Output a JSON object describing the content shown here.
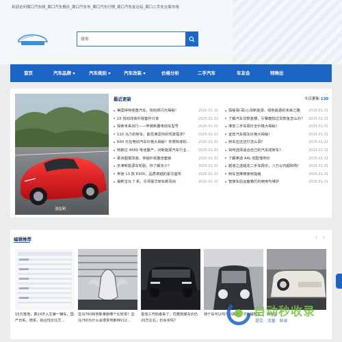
{
  "header": {
    "welcome": "欢迎访问周口汽车网_周口汽车报价_周口汽车市_周口汽车行情_周口汽车友论坛_周口二手车交易市场",
    "logo_text": "周口汽车网",
    "search_placeholder": "搜索"
  },
  "nav": {
    "items": [
      {
        "label": "首页",
        "caret": false
      },
      {
        "label": "汽车品牌",
        "caret": true
      },
      {
        "label": "汽车类别",
        "caret": true
      },
      {
        "label": "汽车改装",
        "caret": true
      },
      {
        "label": "价格分析",
        "caret": false
      },
      {
        "label": "二手汽车",
        "caret": false
      },
      {
        "label": "车友会",
        "caret": false
      },
      {
        "label": "特殊拉",
        "caret": false
      }
    ]
  },
  "hero": {
    "caption": "法拉利"
  },
  "latest": {
    "title": "最近更新",
    "items": [
      {
        "title": "美国得特塔重汽车，快险频闪光揭秘！",
        "date": "2025-01-31"
      },
      {
        "title": "15 悦动改装外观套件分享",
        "date": "2025-01-31"
      },
      {
        "title": "探索未来出行——奔驰新叠电动车型号",
        "date": "2025-01-31"
      },
      {
        "title": "110 马力的轿车，能否满足你的驾驶需求？",
        "date": "2025-01-31"
      },
      {
        "title": "600 元在电动汽车价格大揭秘！你想知道的...",
        "date": "2025-01-31"
      },
      {
        "title": "特斯拉 4680 电池量产，对新能源汽车行业...",
        "date": "2025-01-31"
      },
      {
        "title": "歌诗图报改装，将袖外观量佳套装",
        "date": "2025-01-31"
      },
      {
        "title": "天津新能源车轮胎，你了解多少？",
        "date": "2025-01-31"
      },
      {
        "title": "奔驰 13 款 E300，品质卓越的豪华座驾",
        "date": "2025-01-31"
      },
      {
        "title": "最新宝马 7 系，引领豪华轿车新风尚",
        "date": "2025-01-31"
      }
    ]
  },
  "today": {
    "label": "今日更新",
    "count": "130",
    "items": [
      {
        "title": "探秘哥(哥)心浑新能源，绿色能源的未来之路",
        "date": "2025-01-31"
      },
      {
        "title": "了解汽车贷款金额，引擎磨损过贷款金怎么办？",
        "date": "2025-01-31"
      },
      {
        "title": "淮安二手车报价全价格大揭秘！",
        "date": "2025-01-31"
      },
      {
        "title": "宜宾汽车租车价格大揭秘！",
        "date": "2025-01-31"
      },
      {
        "title": "轿车应还还灯怎么调？",
        "date": "2025-01-31"
      },
      {
        "title": "如何选择适合自己的汽车成轿车？",
        "date": "2025-01-31"
      },
      {
        "title": "了解奥迪 A4L 低配落地价",
        "date": "2025-01-31"
      },
      {
        "title": "越道之选超定二手车报价，八万以内超和购！",
        "date": "2025-01-31"
      },
      {
        "title": "轿车宣推荐使用指南",
        "date": "2025-01-31"
      },
      {
        "title": "智旅车后运备箱们的使用与维护",
        "date": "2025-01-31"
      }
    ]
  },
  "editor": {
    "title": "编辑推荐",
    "prev": "‹",
    "next": "›",
    "cards": [
      {
        "caption": "15万落地，费24岁入生第一辆车，国产日系，德系，综合性价比灵..."
      },
      {
        "caption": "宝马760和劳斯莱斯哪个比较贵？宝马760为什么会很贵劳斯特V12..."
      },
      {
        "caption": "雷佳三开拓者来了，优雅狗爆车价仍20万左右，价余买吗？"
      },
      {
        "caption": "骑个车可以吗？好跑的，才能爆款车"
      },
      {
        "caption": "骑车们"
      }
    ]
  },
  "watermark": {
    "title": "自动秒收录",
    "subtitle": "提交 · 流量 · 收录"
  },
  "colors": {
    "brand": "#1b64c4",
    "nav_bg": "#1b64c4"
  }
}
